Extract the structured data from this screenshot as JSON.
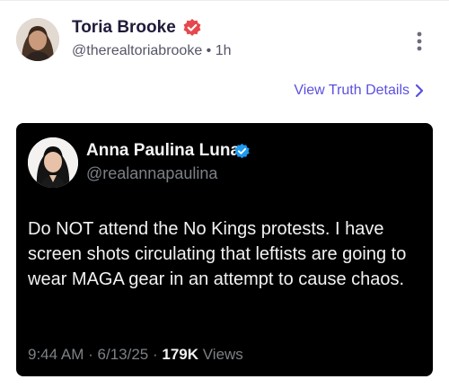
{
  "post": {
    "author_name": "Toria Brooke",
    "author_handle": "@therealtoriabrooke",
    "separator": "•",
    "time_ago": "1h",
    "more_icon": "vertical-ellipsis-icon",
    "verified_icon": "verified-badge-icon",
    "verified_color": "#e5484d",
    "view_details_label": "View Truth Details",
    "view_details_icon": "chevron-right-icon",
    "accent_color": "#5b50e0"
  },
  "embedded_tweet": {
    "author_name": "Anna Paulina Luna",
    "author_handle": "@realannapaulina",
    "verified_icon": "verified-badge-icon",
    "verified_color": "#1d9bf0",
    "text": "Do NOT attend the No Kings protests. I have screen shots circulating that leftists are going to wear MAGA gear in an attempt to cause chaos.",
    "time": "9:44 AM",
    "date": "6/13/25",
    "views_count": "179K",
    "views_label": "Views",
    "separator": "·"
  }
}
